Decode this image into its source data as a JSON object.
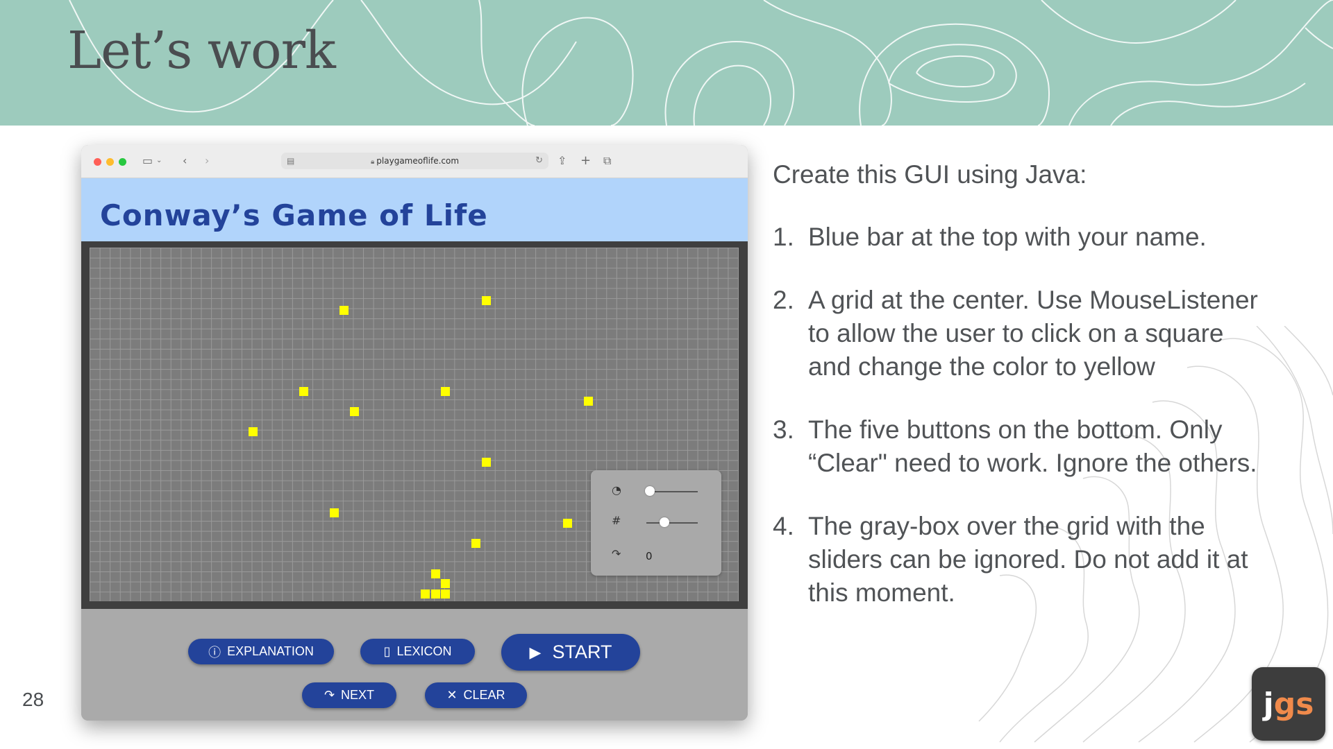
{
  "slide": {
    "title": "Let’s work",
    "page_number": "28",
    "logo": {
      "j": "j",
      "gs": "gs"
    }
  },
  "browser": {
    "url": "playgameoflife.com",
    "app_title": "Conway’s Game of Life",
    "live_cells_note": "yellow cells on gray grid",
    "panel": {
      "generation_count": "0",
      "speed_level": 0.1,
      "size_level": 0.4
    },
    "buttons": {
      "explanation": "EXPLANATION",
      "lexicon": "LEXICON",
      "start": "START",
      "next": "NEXT",
      "clear": "CLEAR"
    },
    "colors": {
      "app_bar": "#b1d4fb",
      "button_blue": "#23439a",
      "live_cell": "#ffff00"
    }
  },
  "instructions": {
    "intro": "Create this GUI using Java:",
    "items": [
      {
        "num": "1.",
        "text": "Blue bar at the top with your name."
      },
      {
        "num": "2.",
        "text": "A grid at the center. Use MouseListener to allow the user to click on a square and change the color to yellow"
      },
      {
        "num": "3.",
        "text": "The five buttons on the bottom. Only “Clear\" need to work. Ignore the others."
      },
      {
        "num": "4.",
        "text": "The gray-box over the grid with the sliders can be ignored. Do not add it at this moment."
      }
    ]
  }
}
